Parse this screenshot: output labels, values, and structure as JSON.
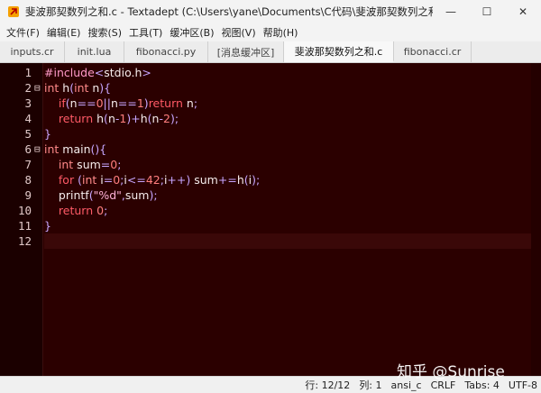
{
  "window": {
    "title": "斐波那契数列之和.c - Textadept (C:\\Users\\yane\\Documents\\C代码\\斐波那契数列之和.c)",
    "icons": {
      "app": "textadept-icon",
      "minimize": "minimize-icon",
      "maximize": "maximize-icon",
      "close": "close-icon"
    },
    "glyphs": {
      "minimize": "—",
      "maximize": "☐",
      "close": "✕"
    }
  },
  "menu": [
    {
      "label": "文件(F)"
    },
    {
      "label": "编辑(E)"
    },
    {
      "label": "搜索(S)"
    },
    {
      "label": "工具(T)"
    },
    {
      "label": "缓冲区(B)"
    },
    {
      "label": "视图(V)"
    },
    {
      "label": "帮助(H)"
    }
  ],
  "tabs": [
    {
      "label": "inputs.cr",
      "active": false
    },
    {
      "label": "init.lua",
      "active": false
    },
    {
      "label": "fibonacci.py",
      "active": false
    },
    {
      "label": "[消息缓冲区]",
      "active": false
    },
    {
      "label": "斐波那契数列之和.c",
      "active": true
    },
    {
      "label": "fibonacci.cr",
      "active": false
    }
  ],
  "editor": {
    "current_line": 12,
    "lines": [
      {
        "num": "1",
        "fold": "",
        "indent": "",
        "tokens": [
          [
            "pre",
            "#include"
          ],
          [
            "op",
            "<"
          ],
          [
            "id",
            "stdio.h"
          ],
          [
            "op",
            ">"
          ]
        ]
      },
      {
        "num": "2",
        "fold": "⊟",
        "indent": "",
        "tokens": [
          [
            "type",
            "int"
          ],
          [
            "id",
            " h"
          ],
          [
            "br",
            "("
          ],
          [
            "type",
            "int"
          ],
          [
            "id",
            " n"
          ],
          [
            "br",
            "){"
          ]
        ]
      },
      {
        "num": "3",
        "fold": "",
        "indent": "    ",
        "tokens": [
          [
            "kw",
            "if"
          ],
          [
            "br",
            "("
          ],
          [
            "id",
            "n"
          ],
          [
            "op",
            "=="
          ],
          [
            "num",
            "0"
          ],
          [
            "op",
            "||"
          ],
          [
            "id",
            "n"
          ],
          [
            "op",
            "=="
          ],
          [
            "num",
            "1"
          ],
          [
            "br",
            ")"
          ],
          [
            "kw",
            "return"
          ],
          [
            "id",
            " n"
          ],
          [
            "op",
            ";"
          ]
        ]
      },
      {
        "num": "4",
        "fold": "",
        "indent": "    ",
        "tokens": [
          [
            "kw",
            "return"
          ],
          [
            "id",
            " h"
          ],
          [
            "br",
            "("
          ],
          [
            "id",
            "n"
          ],
          [
            "op",
            "-"
          ],
          [
            "num",
            "1"
          ],
          [
            "br",
            ")"
          ],
          [
            "op",
            "+"
          ],
          [
            "id",
            "h"
          ],
          [
            "br",
            "("
          ],
          [
            "id",
            "n"
          ],
          [
            "op",
            "-"
          ],
          [
            "num",
            "2"
          ],
          [
            "br",
            ")"
          ],
          [
            "op",
            ";"
          ]
        ]
      },
      {
        "num": "5",
        "fold": "",
        "indent": "",
        "tokens": [
          [
            "br",
            "}"
          ]
        ]
      },
      {
        "num": "6",
        "fold": "⊟",
        "indent": "",
        "tokens": [
          [
            "type",
            "int"
          ],
          [
            "id",
            " main"
          ],
          [
            "br",
            "(){"
          ]
        ]
      },
      {
        "num": "7",
        "fold": "",
        "indent": "    ",
        "tokens": [
          [
            "type",
            "int"
          ],
          [
            "id",
            " sum"
          ],
          [
            "op",
            "="
          ],
          [
            "num",
            "0"
          ],
          [
            "op",
            ";"
          ]
        ]
      },
      {
        "num": "8",
        "fold": "",
        "indent": "    ",
        "tokens": [
          [
            "kw",
            "for"
          ],
          [
            "id",
            " "
          ],
          [
            "br",
            "("
          ],
          [
            "type",
            "int"
          ],
          [
            "id",
            " i"
          ],
          [
            "op",
            "="
          ],
          [
            "num",
            "0"
          ],
          [
            "op",
            ";"
          ],
          [
            "id",
            "i"
          ],
          [
            "op",
            "<="
          ],
          [
            "num",
            "42"
          ],
          [
            "op",
            ";"
          ],
          [
            "id",
            "i"
          ],
          [
            "op",
            "++"
          ],
          [
            "br",
            ")"
          ],
          [
            "id",
            " sum"
          ],
          [
            "op",
            "+="
          ],
          [
            "id",
            "h"
          ],
          [
            "br",
            "("
          ],
          [
            "id",
            "i"
          ],
          [
            "br",
            ")"
          ],
          [
            "op",
            ";"
          ]
        ]
      },
      {
        "num": "9",
        "fold": "",
        "indent": "    ",
        "tokens": [
          [
            "id",
            "printf"
          ],
          [
            "br",
            "("
          ],
          [
            "str",
            "\"%d\""
          ],
          [
            "op",
            ","
          ],
          [
            "id",
            "sum"
          ],
          [
            "br",
            ")"
          ],
          [
            "op",
            ";"
          ]
        ]
      },
      {
        "num": "10",
        "fold": "",
        "indent": "    ",
        "tokens": [
          [
            "kw",
            "return"
          ],
          [
            "id",
            " "
          ],
          [
            "num",
            "0"
          ],
          [
            "op",
            ";"
          ]
        ]
      },
      {
        "num": "11",
        "fold": "",
        "indent": "",
        "tokens": [
          [
            "br",
            "}"
          ]
        ]
      },
      {
        "num": "12",
        "fold": "",
        "indent": "",
        "tokens": []
      }
    ]
  },
  "status": {
    "line": "行: 12/12",
    "column": "列: 1",
    "lexer": "ansi_c",
    "eol": "CRLF",
    "tabs": "Tabs: 4",
    "encoding": "UTF-8"
  },
  "watermark": "知乎 @Sunrise",
  "colors": {
    "editor_bg": "#2b0000",
    "gutter_bg": "#1b0000",
    "keyword": "#ff5a66",
    "operator": "#c7a6ff"
  }
}
